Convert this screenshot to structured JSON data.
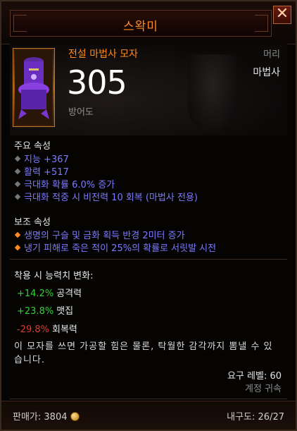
{
  "header": {
    "title": "스왁미",
    "close_label": "✕"
  },
  "item": {
    "type": "전설 마법사 모자",
    "slot": "머리",
    "class": "마법사",
    "armor_value": "305",
    "armor_label": "방어도"
  },
  "primary": {
    "title": "주요 속성",
    "attributes": [
      {
        "text": "지능 +367",
        "bullet": "gray"
      },
      {
        "text": "활력 +517",
        "bullet": "gray"
      },
      {
        "text": "극대화 확률 6.0% 증가",
        "bullet": "gray"
      },
      {
        "text": "극대화 적중 시 비전력 10 회복 (마법사 전용)",
        "bullet": "gray"
      }
    ]
  },
  "secondary": {
    "title": "보조 속성",
    "attributes": [
      {
        "text": "생명의 구슬 및 금화 획득 반경 2미터 증가",
        "bullet": "orange"
      },
      {
        "text": "냉기 피해로 죽은 적이 25%의 확률로 서릿발 시전",
        "bullet": "orange"
      }
    ]
  },
  "changes": {
    "title": "착용 시 능력치 변화:",
    "items": [
      {
        "value": "+14.2%",
        "label": "공격력",
        "sign": "pos"
      },
      {
        "value": "+23.8%",
        "label": "맷집",
        "sign": "pos"
      },
      {
        "value": "-29.8%",
        "label": "회복력",
        "sign": "neg"
      }
    ]
  },
  "flavor": "이 모자를 쓰면 가공할 힘은 물론, 탁월한 감각까지 뽐낼 수 있습니다.",
  "requirement": "요구 레벨: 60",
  "bound": "계정 귀속",
  "footer": {
    "sell_label": "판매가:",
    "sell_value": "3804",
    "durability_label": "내구도:",
    "durability_value": "26/27"
  },
  "colors": {
    "legendary": "#ff8a1f",
    "magic": "#7b7bff",
    "positive": "#32d232",
    "negative": "#e03a2a"
  },
  "icons": [
    "close-icon",
    "wizard-hat-icon",
    "gold-coin-icon"
  ]
}
